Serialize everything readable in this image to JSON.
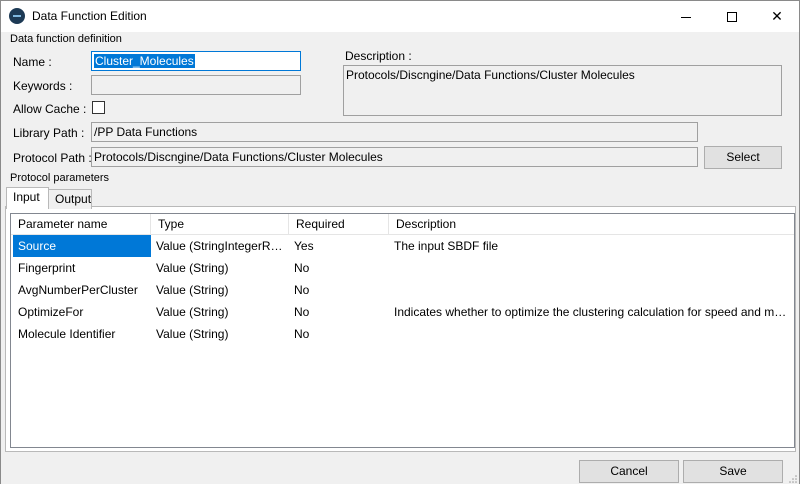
{
  "window": {
    "title": "Data Function Edition"
  },
  "definition": {
    "section_label": "Data function definition",
    "name_label": "Name :",
    "name_value": "Cluster_Molecules",
    "keywords_label": "Keywords :",
    "keywords_value": "",
    "allow_cache_label": "Allow Cache :",
    "allow_cache_checked": false,
    "description_label": "Description :",
    "description_value": "Protocols/Discngine/Data Functions/Cluster Molecules",
    "library_path_label": "Library Path :",
    "library_path_value": "/PP Data Functions",
    "protocol_path_label": "Protocol Path :",
    "protocol_path_value": "Protocols/Discngine/Data Functions/Cluster Molecules",
    "select_label": "Select"
  },
  "parameters": {
    "section_label": "Protocol parameters",
    "tabs": [
      {
        "label": "Input",
        "active": true
      },
      {
        "label": "Output",
        "active": false
      }
    ],
    "columns": [
      "Parameter name",
      "Type",
      "Required",
      "Description"
    ],
    "rows": [
      {
        "name": "Source",
        "type": "Value (StringIntegerReal...",
        "required": "Yes",
        "description": "The input SBDF file",
        "selected": true
      },
      {
        "name": "Fingerprint",
        "type": "Value (String)",
        "required": "No",
        "description": ""
      },
      {
        "name": "AvgNumberPerCluster",
        "type": "Value (String)",
        "required": "No",
        "description": ""
      },
      {
        "name": "OptimizeFor",
        "type": "Value (String)",
        "required": "No",
        "description": "Indicates whether to optimize the clustering calculation for speed and memory or f..."
      },
      {
        "name": "Molecule Identifier",
        "type": "Value (String)",
        "required": "No",
        "description": ""
      }
    ]
  },
  "footer": {
    "cancel_label": "Cancel",
    "save_label": "Save"
  }
}
